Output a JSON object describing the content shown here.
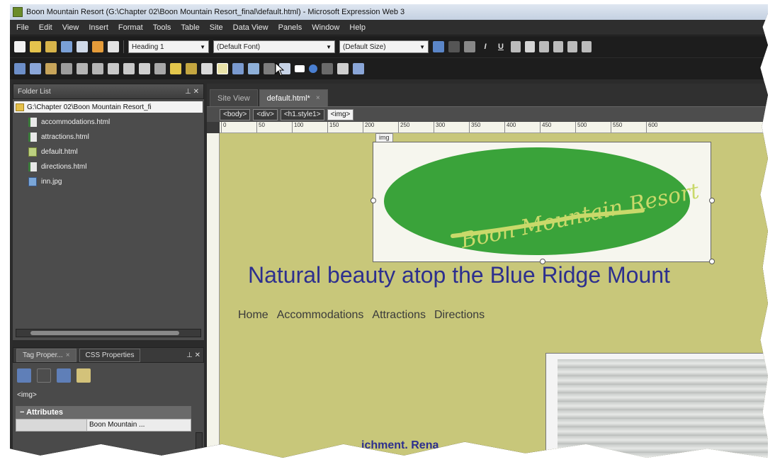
{
  "window": {
    "title": "Boon Mountain Resort (G:\\Chapter 02\\Boon Mountain Resort_final\\default.html) - Microsoft Expression Web 3"
  },
  "menu": [
    "File",
    "Edit",
    "View",
    "Insert",
    "Format",
    "Tools",
    "Table",
    "Site",
    "Data View",
    "Panels",
    "Window",
    "Help"
  ],
  "toolbar": {
    "style_value": "Heading 1",
    "font_value": "(Default Font)",
    "size_value": "(Default Size)",
    "bold": "B",
    "italic": "I",
    "underline": "U"
  },
  "folder_list": {
    "title": "Folder List",
    "root": "G:\\Chapter 02\\Boon Mountain Resort_fi",
    "files": [
      {
        "name": "accommodations.html",
        "type": "html"
      },
      {
        "name": "attractions.html",
        "type": "html"
      },
      {
        "name": "default.html",
        "type": "home"
      },
      {
        "name": "directions.html",
        "type": "html"
      },
      {
        "name": "inn.jpg",
        "type": "jpg"
      }
    ]
  },
  "tag_properties": {
    "tab1": "Tag Proper...",
    "tab2": "CSS Properties",
    "current_tag": "<img>",
    "section": "Attributes",
    "row_value": "Boon Mountain ..."
  },
  "editor": {
    "tabs": [
      "Site View",
      "default.html*"
    ],
    "quick_tags": [
      "<body>",
      "<div>",
      "<h1.style1>",
      "<img>"
    ],
    "ruler_marks": [
      "0",
      "50",
      "100",
      "150",
      "200",
      "250",
      "300",
      "350",
      "400",
      "450",
      "500",
      "550",
      "600"
    ],
    "img_label": "img"
  },
  "page": {
    "logo_text": "Boon Mountain Resort",
    "headline": "Natural beauty atop the Blue Ridge Mount",
    "nav": [
      "Home",
      "Accommodations",
      "Attractions",
      "Directions"
    ],
    "partial_text": "ichment. Rena"
  },
  "colors": {
    "page_bg": "#c8c77a",
    "headline": "#2d2f8e",
    "logo_ellipse": "#3aa33a",
    "logo_text": "#c9d96a"
  }
}
